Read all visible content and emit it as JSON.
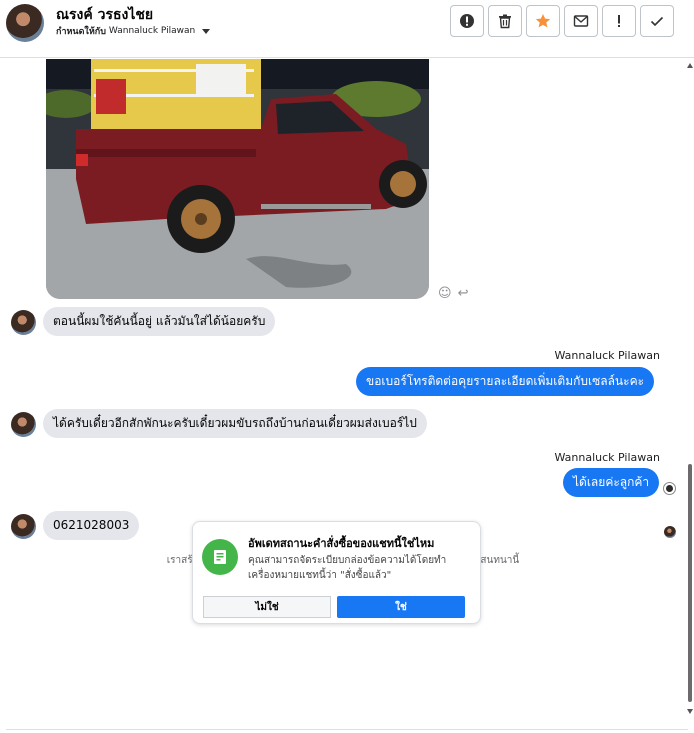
{
  "header": {
    "contact_name": "ณรงค์ วรธงไชย",
    "assigned_label": "กำหนดให้กับ",
    "assigned_to": "Wannaluck Pilawan"
  },
  "toolbar": [
    {
      "name": "mark-spam-button",
      "icon": "alert-circle-icon"
    },
    {
      "name": "delete-button",
      "icon": "trash-icon"
    },
    {
      "name": "star-button",
      "icon": "star-icon",
      "color": "#f7923a"
    },
    {
      "name": "mark-unread-button",
      "icon": "envelope-icon"
    },
    {
      "name": "follow-up-button",
      "icon": "exclamation-icon"
    },
    {
      "name": "mark-done-button",
      "icon": "check-icon"
    }
  ],
  "messages": [
    {
      "direction": "in",
      "text": "ตอนนี้ผมใช้คันนี้อยู่ แล้วมันใส่ได้น้อยครับ"
    },
    {
      "direction": "out",
      "sender": "Wannaluck Pilawan",
      "text": "ขอเบอร์โทรติดต่อคุยรายละเอียดเพิ่มเติมกับเซลล์นะคะ"
    },
    {
      "direction": "in",
      "text": "ได้ครับเดี๋ยวอีกสักพักนะครับเดี๋ยวผมขับรถถึงบ้านก่อนเดี๋ยวผมส่งเบอร์ไป"
    },
    {
      "direction": "out",
      "sender": "Wannaluck Pilawan",
      "text": "ได้เลยค่ะลูกค้า"
    },
    {
      "direction": "in",
      "text": "0621028003"
    }
  ],
  "system_note": "เราสร้างกิจกรรมของลูกค้าเป้าหมายให้กับคุณโดยอัตโนมัติโดยอิงตามการสนทนานี้",
  "prompt_card": {
    "title": "อัพเดทสถานะคำสั่งซื้อของแชทนี้ใช่ไหม",
    "body": "คุณสามารถจัดระเบียบกล่องข้อความได้โดยทำเครื่องหมายแชทนี้ว่า \"สั่งซื้อแล้ว\"",
    "no_label": "ไม่ใช่",
    "yes_label": "ใช่"
  },
  "colors": {
    "accent": "#1877f2",
    "incoming_bubble": "#e4e6eb",
    "card_icon": "#44b549"
  }
}
